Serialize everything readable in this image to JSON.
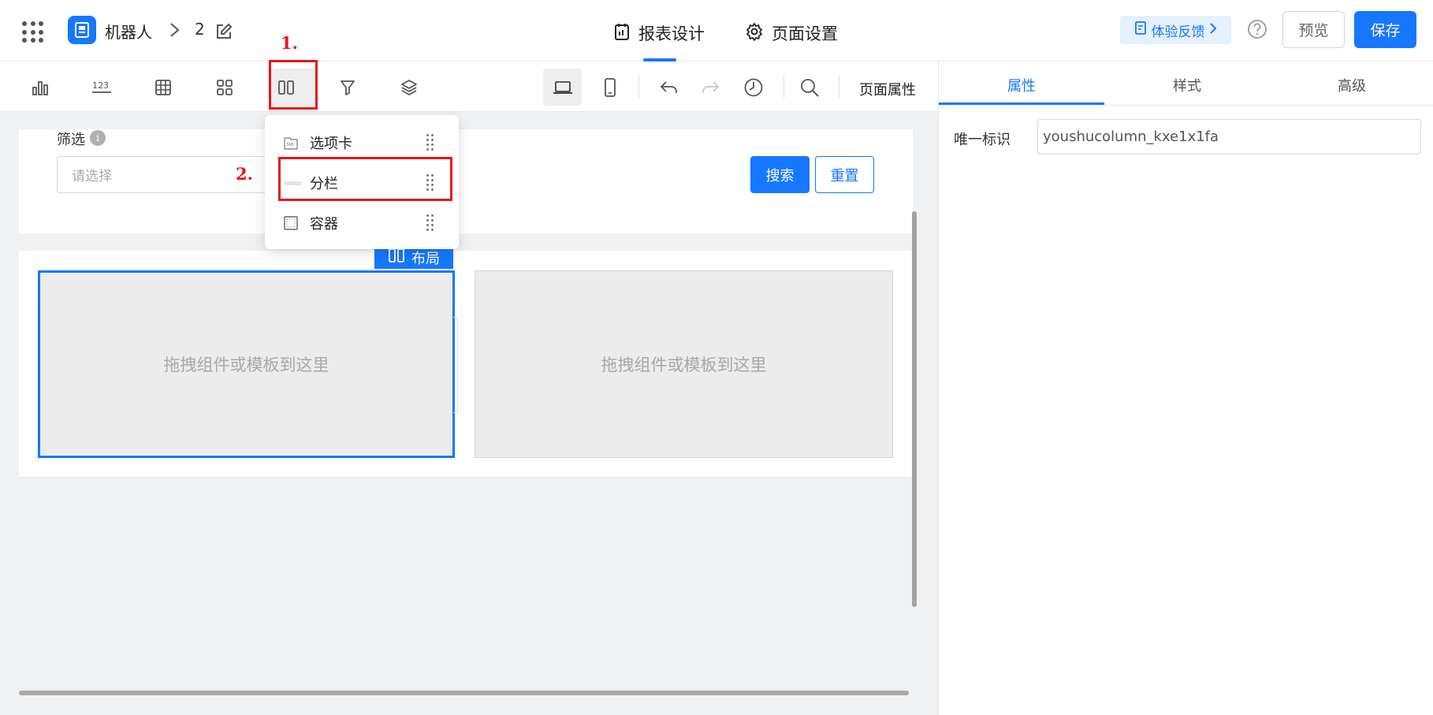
{
  "header": {
    "app_name": "机器人",
    "report_name": "2",
    "tabs": [
      {
        "label": "报表设计",
        "icon": "report-design-icon",
        "active": true
      },
      {
        "label": "页面设置",
        "icon": "gear-icon",
        "active": false
      }
    ],
    "feedback_label": "体验反馈",
    "preview_label": "预览",
    "save_label": "保存"
  },
  "toolbar": {
    "components": [
      "chart-icon",
      "number-icon",
      "table-icon",
      "widgets-icon",
      "layout-columns-icon",
      "filter-icon",
      "layers-icon"
    ],
    "page_properties_label": "页面属性"
  },
  "canvas": {
    "filter_label": "筛选",
    "filter_info": "i",
    "filter_placeholder": "请选择",
    "search_label": "搜索",
    "reset_label": "重置",
    "layout_tag_label": "布局",
    "column_placeholder_left": "拖拽组件或模板到这里",
    "column_placeholder_right": "拖拽组件或模板到这里"
  },
  "dropdown": {
    "items": [
      {
        "label": "选项卡",
        "icon": "tab-icon",
        "icon_text": "TAB"
      },
      {
        "label": "分栏",
        "icon": "columns-icon"
      },
      {
        "label": "容器",
        "icon": "container-icon"
      }
    ]
  },
  "annotations": {
    "step1": "1.",
    "step2": "2.",
    "color": "#e8141e"
  },
  "right_panel": {
    "tabs": [
      {
        "label": "属性",
        "active": true
      },
      {
        "label": "样式",
        "active": false
      },
      {
        "label": "高级",
        "active": false
      }
    ],
    "unique_id_label": "唯一标识",
    "unique_id_value": "youshucolumn_kxe1x1fa"
  },
  "colors": {
    "primary": "#1677ff",
    "annotation_red": "#e8141e",
    "canvas_bg": "#f0f1f3"
  }
}
